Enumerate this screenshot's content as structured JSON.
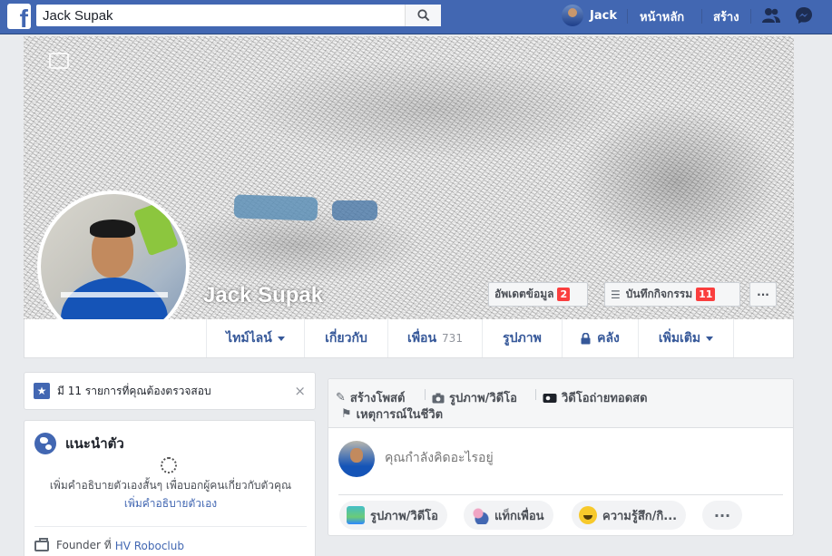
{
  "topbar": {
    "logo": "f",
    "search_value": "Jack Supak",
    "user_name": "Jack",
    "home_label": "หน้าหลัก",
    "create_label": "สร้าง",
    "icons": [
      "search-icon",
      "friends-icon",
      "messenger-icon"
    ],
    "brand_color": "#4267b2"
  },
  "profile": {
    "name": "Jack Supak",
    "update_info_label": "อัพเดตข้อมูล",
    "update_info_badge": "2",
    "activity_log_label": "บันทึกกิจกรรม",
    "activity_log_badge": "11",
    "more_label": "···"
  },
  "tabs": [
    {
      "label": "ไทม์ไลน์",
      "dropdown": true
    },
    {
      "label": "เกี่ยวกับ"
    },
    {
      "label": "เพื่อน",
      "count": "731"
    },
    {
      "label": "รูปภาพ"
    },
    {
      "label": "คลัง",
      "icon": "lock-icon"
    },
    {
      "label": "เพิ่มเติม",
      "dropdown": true
    }
  ],
  "review": {
    "text": "มี 11 รายการที่คุณต้องตรวจสอบ",
    "close": "×"
  },
  "intro": {
    "title": "แนะนำตัว",
    "description": "เพิ่มคำอธิบายตัวเองสั้นๆ เพื่อบอกผู้คนเกี่ยวกับตัวคุณ",
    "add_link": "เพิ่มคำอธิบายตัวเอง",
    "work_prefix": "Founder ที่",
    "work_place": "HV Roboclub"
  },
  "composer": {
    "create_post": "สร้างโพสต์",
    "photo_video": "รูปภาพ/วิดีโอ",
    "live_video": "วิดีโอถ่ายทอดสด",
    "life_event": "เหตุการณ์ในชีวิต",
    "placeholder": "คุณกำลังคิดอะไรอยู่",
    "action_photo": "รูปภาพ/วิดีโอ",
    "action_tag": "แท็กเพื่อน",
    "action_feeling": "ความรู้สึก/กิ...",
    "action_more": "···"
  }
}
